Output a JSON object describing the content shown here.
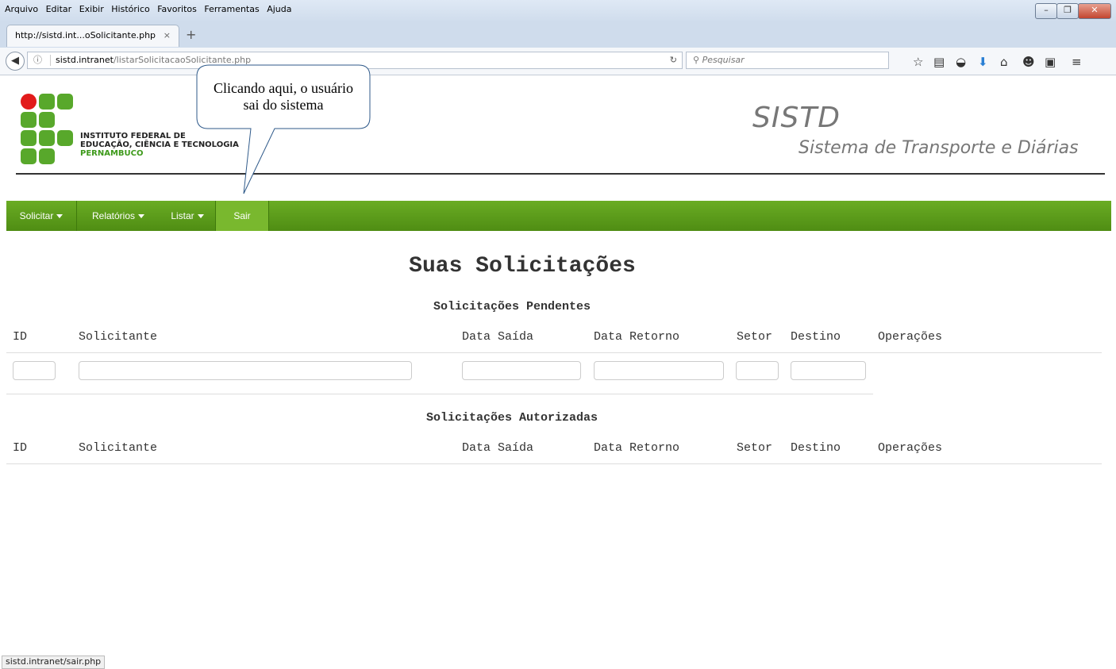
{
  "browser": {
    "menu": [
      "Arquivo",
      "Editar",
      "Exibir",
      "Histórico",
      "Favoritos",
      "Ferramentas",
      "Ajuda"
    ],
    "tab_title": "http://sistd.int...oSolicitante.php",
    "tab_close": "×",
    "new_tab": "+",
    "url_host": "sistd.intranet",
    "url_path": "/listarSolicitacaoSolicitante.php",
    "search_placeholder": "Pesquisar",
    "status_url": "sistd.intranet/sair.php"
  },
  "header": {
    "institute_line1": "INSTITUTO FEDERAL DE",
    "institute_line2": "EDUCAÇÃO, CIÊNCIA E TECNOLOGIA",
    "institute_line3": "PERNAMBUCO",
    "app_title": "SISTD",
    "app_subtitle": "Sistema de Transporte e Diárias"
  },
  "callout": {
    "line1": "Clicando aqui, o usuário",
    "line2": "sai do sistema"
  },
  "nav": [
    {
      "label": "Solicitar",
      "dropdown": true
    },
    {
      "label": "Relatórios",
      "dropdown": true
    },
    {
      "label": "Listar",
      "dropdown": true
    },
    {
      "label": "Sair",
      "dropdown": false
    }
  ],
  "main": {
    "title": "Suas Solicitações",
    "pending_title": "Solicitações Pendentes",
    "authorized_title": "Solicitações Autorizadas",
    "columns": [
      "ID",
      "Solicitante",
      "Data Saída",
      "Data Retorno",
      "Setor",
      "Destino",
      "Operações"
    ]
  },
  "colors": {
    "nav_green": "#5a9c1a",
    "logo_green": "#58a82b",
    "logo_red": "#e21b1b"
  }
}
